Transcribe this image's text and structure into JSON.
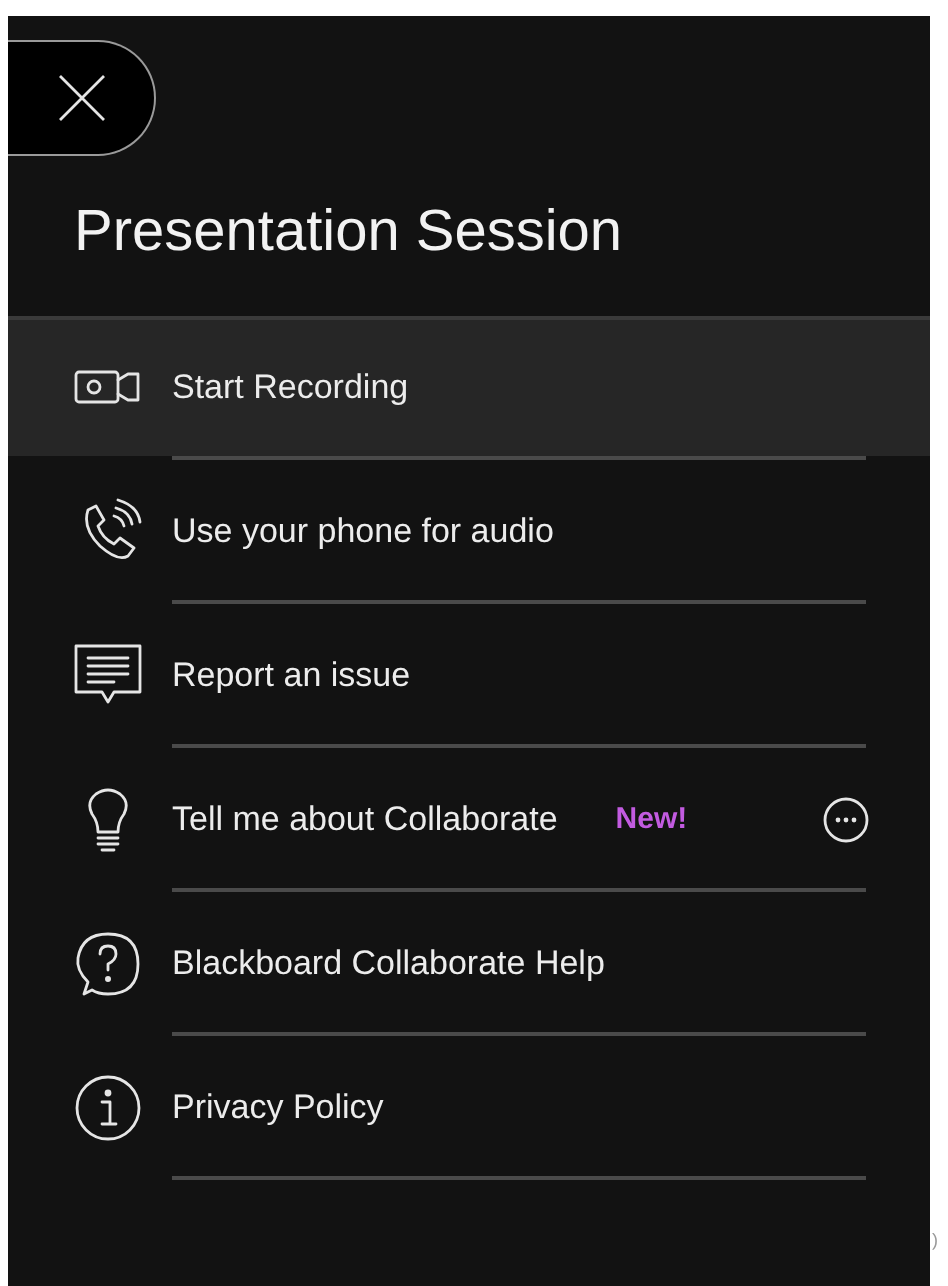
{
  "title": "Presentation Session",
  "menu": [
    {
      "kind": "record",
      "label": "Start Recording",
      "selected": true
    },
    {
      "kind": "phone",
      "label": "Use your phone for audio",
      "selected": false
    },
    {
      "kind": "report",
      "label": "Report an issue",
      "selected": false
    },
    {
      "kind": "tips",
      "label": "Tell me about Collaborate",
      "selected": false,
      "badge": "New!",
      "more_menu": true
    },
    {
      "kind": "help",
      "label": "Blackboard Collaborate Help",
      "selected": false
    },
    {
      "kind": "privacy",
      "label": "Privacy Policy",
      "selected": false
    }
  ],
  "edge_glyph": ")"
}
